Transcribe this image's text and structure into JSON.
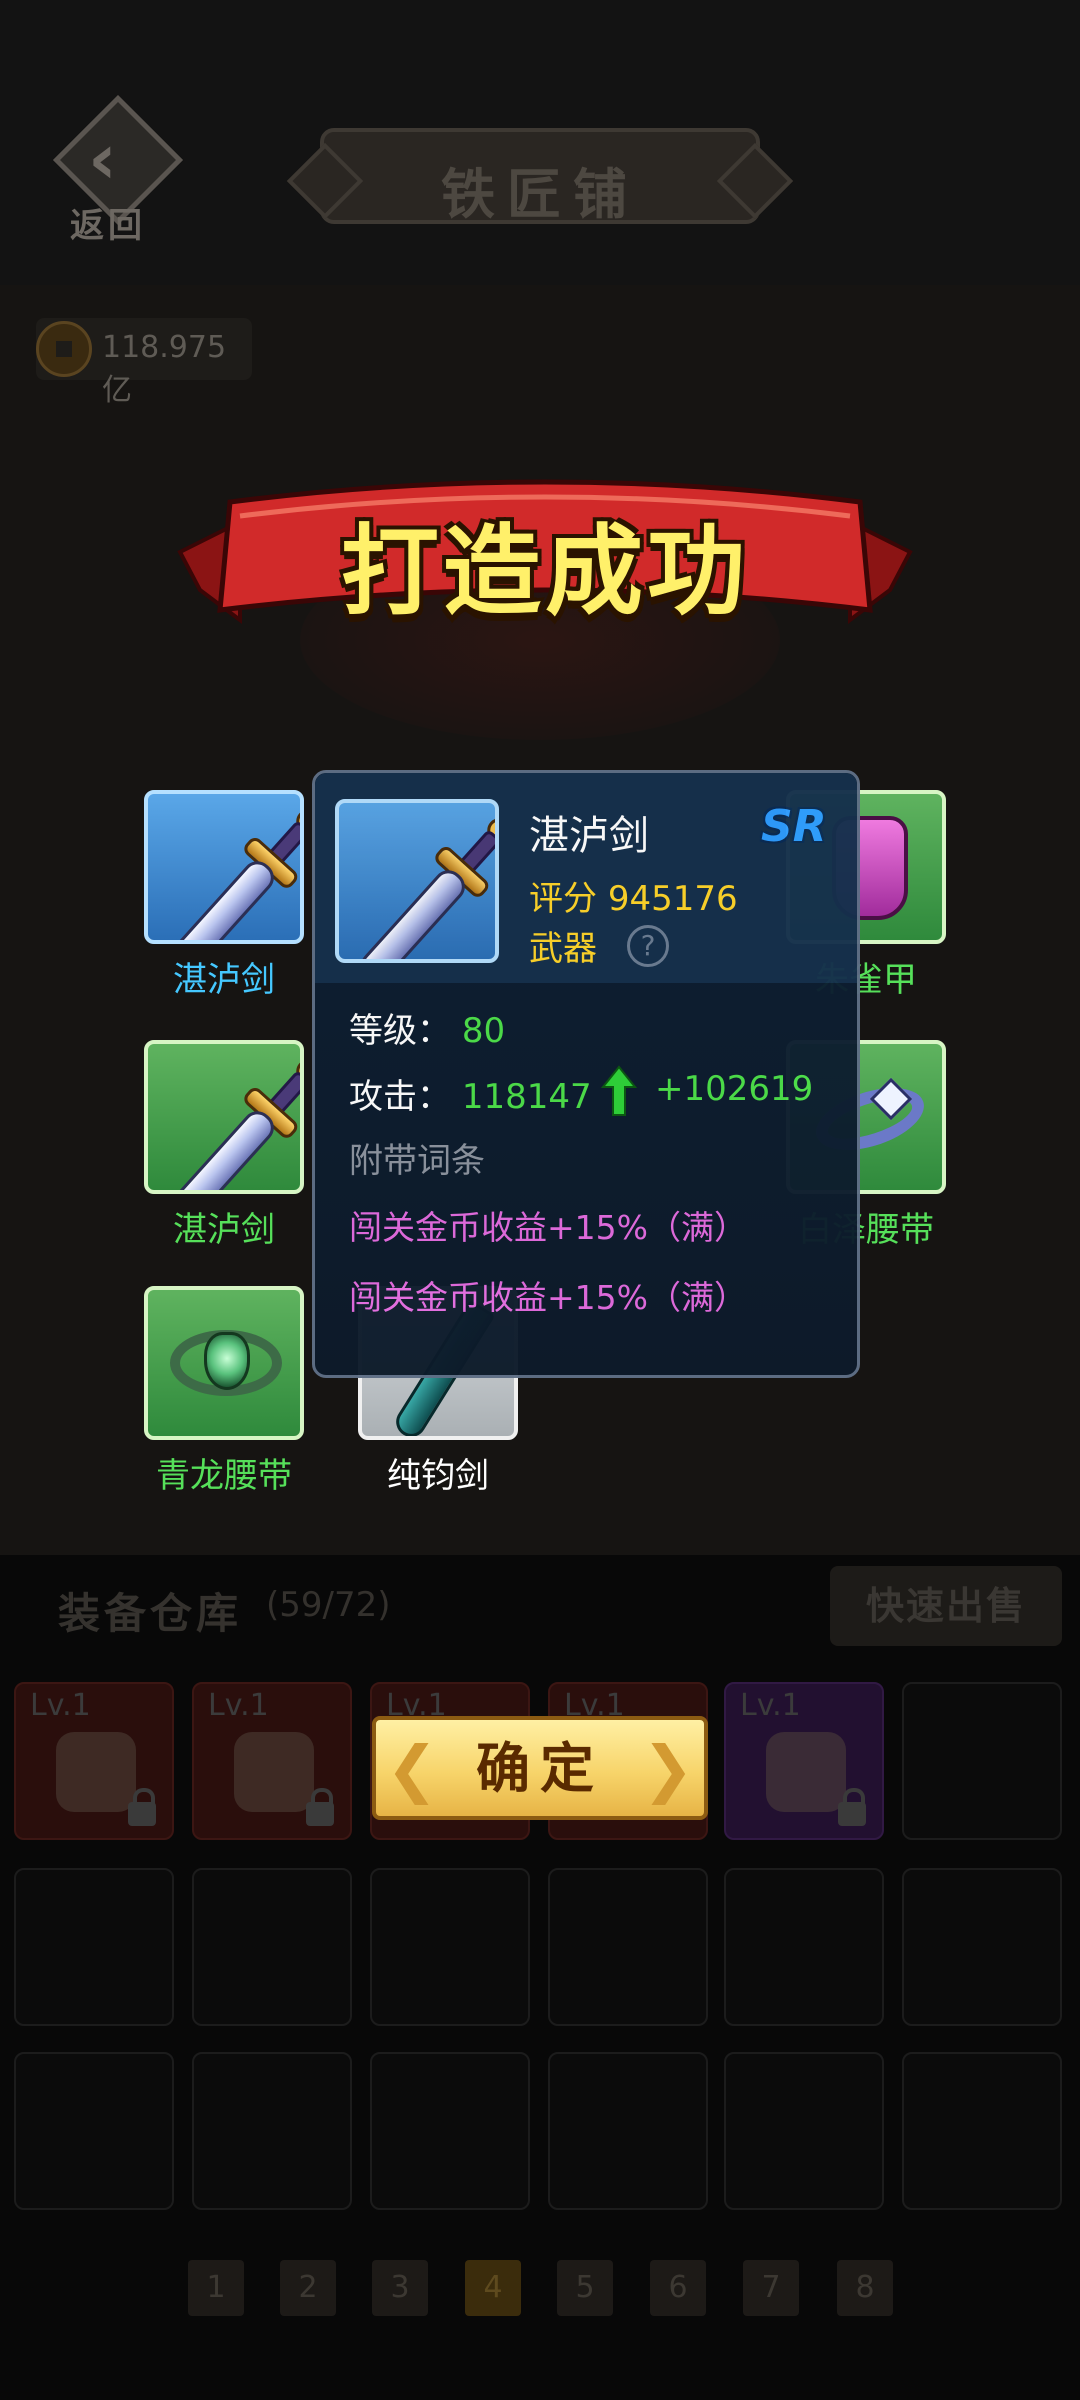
{
  "header": {
    "back_label": "返回",
    "title": "铁匠铺"
  },
  "currency": {
    "amount": "118.975亿"
  },
  "warehouse": {
    "title": "装备仓库",
    "count": "(59/72)",
    "quick_sell": "快速出售",
    "slots": [
      {
        "level": "Lv.1",
        "tier": "red"
      },
      {
        "level": "Lv.1",
        "tier": "red"
      },
      {
        "level": "Lv.1",
        "tier": "red"
      },
      {
        "level": "Lv.1",
        "tier": "red"
      },
      {
        "level": "Lv.1",
        "tier": "purple"
      }
    ],
    "pages": [
      "1",
      "2",
      "3",
      "4",
      "5",
      "6",
      "7",
      "8"
    ],
    "active_page": "4"
  },
  "result": {
    "banner": "打造成功",
    "items": [
      {
        "name": "湛泸剑",
        "tier": "blue",
        "icon": "sword-icon",
        "name_color": "#45c8ff"
      },
      {
        "name": "湛泸剑",
        "tier": "green",
        "icon": "sword-icon",
        "name_color": "#56e05a"
      },
      {
        "name": "青龙腰带",
        "tier": "green",
        "icon": "belt-icon",
        "name_color": "#56e05a"
      },
      {
        "name": "纯钧剑",
        "tier": "gray",
        "icon": "sword-icon",
        "name_color": "#ffffff"
      },
      {
        "name": "朱雀甲",
        "tier": "green",
        "icon": "armor-icon",
        "name_color": "#56e05a"
      },
      {
        "name": "白泽腰带",
        "tier": "green",
        "icon": "ring-belt-icon",
        "name_color": "#56e05a"
      }
    ],
    "confirm_label": "确定"
  },
  "popup": {
    "name": "湛泸剑",
    "rarity": "SR",
    "score_label": "评分",
    "score": "945176",
    "type": "武器",
    "help": "?",
    "level_label": "等级：",
    "level": "80",
    "attack_label": "攻击：",
    "attack": "118147",
    "attack_gain": "+102619",
    "affix_title": "附带词条",
    "affixes": [
      "闯关金币收益+15%（满）",
      "闯关金币收益+15%（满）"
    ]
  },
  "colors": {
    "accent_gold": "#ffd42a",
    "stat_green": "#4de04a",
    "affix_pink": "#e36ce0",
    "rarity_blue": "#2e9cff"
  }
}
